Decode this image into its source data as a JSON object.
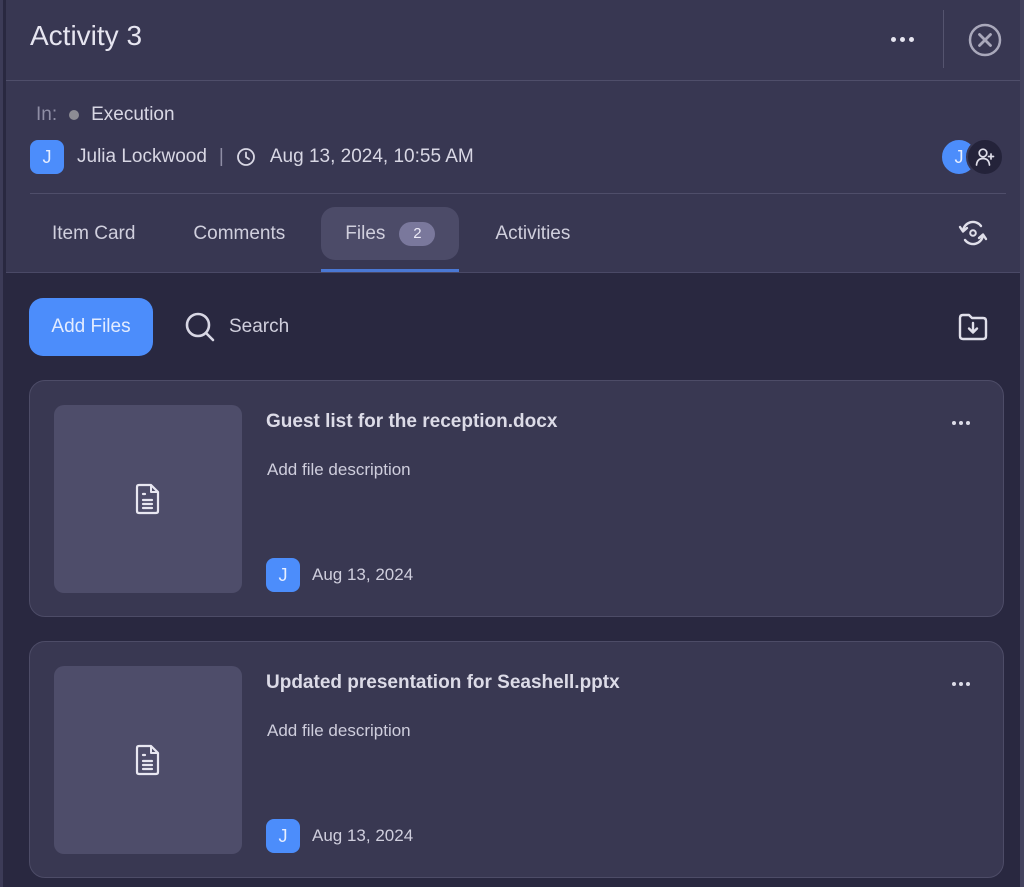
{
  "header": {
    "title": "Activity 3",
    "in_label": "In:",
    "status": "Execution",
    "status_color": "#8d8c94",
    "owner": {
      "initial": "J",
      "name": "Julia Lockwood"
    },
    "timestamp": "Aug 13, 2024, 10:55 AM",
    "assignee_initial": "J",
    "icons": {
      "more": "more-horizontal-icon",
      "close": "close-circle-icon",
      "clock": "clock-icon",
      "add_person": "add-person-icon",
      "sync": "sync-icon"
    }
  },
  "tabs": [
    {
      "label": "Item Card",
      "active": false
    },
    {
      "label": "Comments",
      "active": false
    },
    {
      "label": "Files",
      "active": true,
      "badge": "2"
    },
    {
      "label": "Activities",
      "active": false
    }
  ],
  "toolbar": {
    "add_files_label": "Add Files",
    "search_label": "Search",
    "download_icon": "folder-download-icon"
  },
  "files": [
    {
      "name": "Guest list for the reception.docx",
      "description": "Add file description",
      "uploader_initial": "J",
      "date": "Aug 13, 2024"
    },
    {
      "name": "Updated presentation for Seashell.pptx",
      "description": "Add file description",
      "uploader_initial": "J",
      "date": "Aug 13, 2024"
    }
  ],
  "colors": {
    "accent": "#4c8dfb",
    "tab_indicator": "#4a78d4",
    "header_bg": "#383752",
    "body_bg": "#292840",
    "card_bg": "#393852"
  }
}
